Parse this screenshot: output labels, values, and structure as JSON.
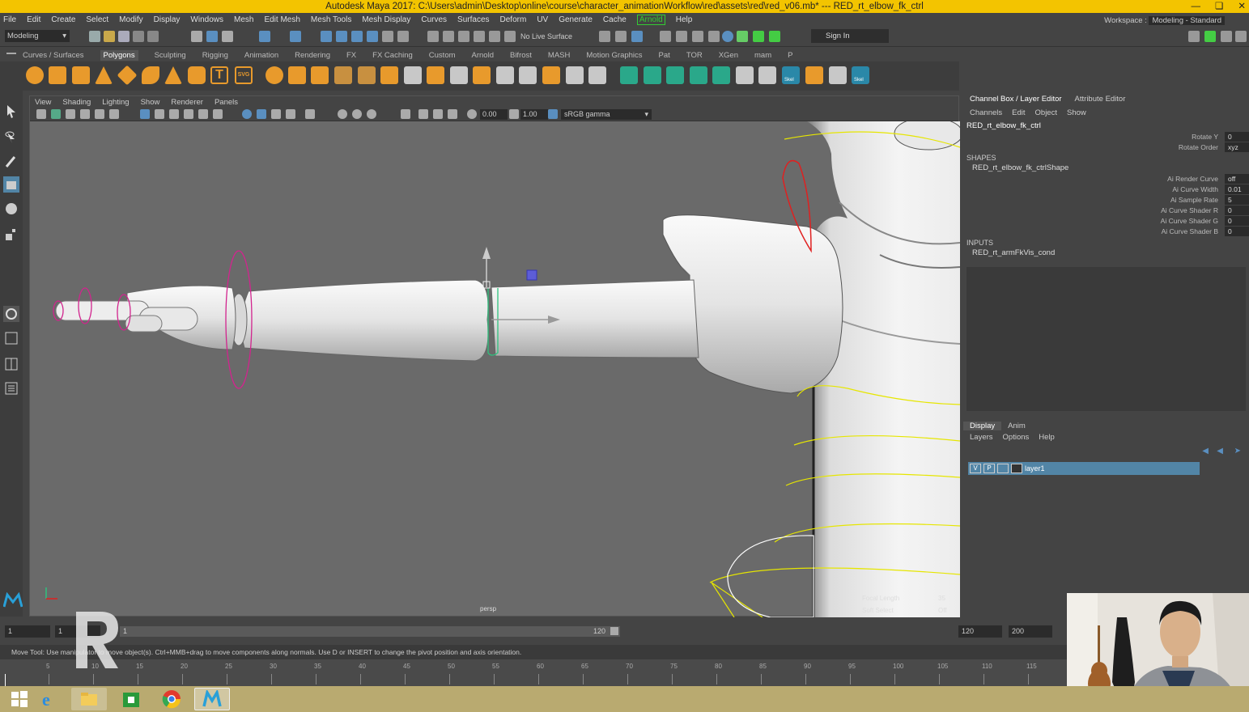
{
  "window": {
    "title": "Autodesk Maya 2017: C:\\Users\\admin\\Desktop\\online\\course\\character_animationWorkflow\\red\\assets\\red\\red_v06.mb*   ---   RED_rt_elbow_fk_ctrl"
  },
  "menubar": {
    "items": [
      "File",
      "Edit",
      "Create",
      "Select",
      "Modify",
      "Display",
      "Windows",
      "Mesh",
      "Edit Mesh",
      "Mesh Tools",
      "Mesh Display",
      "Curves",
      "Surfaces",
      "Deform",
      "UV",
      "Generate",
      "Cache",
      "Arnold",
      "Help"
    ]
  },
  "statusline": {
    "mode": "Modeling",
    "live_surface": "No Live Surface",
    "sign_in": "Sign In",
    "workspace_label": "Workspace :",
    "workspace_value": "Modeling - Standard"
  },
  "shelf": {
    "tabs": [
      "Curves / Surfaces",
      "Polygons",
      "Sculpting",
      "Rigging",
      "Animation",
      "Rendering",
      "FX",
      "FX Caching",
      "Custom",
      "Arnold",
      "Bifrost",
      "MASH",
      "Motion Graphics",
      "Pat",
      "TOR",
      "XGen",
      "mam",
      "P"
    ],
    "active_tab": "Polygons",
    "skel_label": "Skel"
  },
  "viewport": {
    "menu": [
      "View",
      "Shading",
      "Lighting",
      "Show",
      "Renderer",
      "Panels"
    ],
    "near_value": "0.00",
    "far_value": "1.00",
    "color_space": "sRGB gamma",
    "camera_label": "persp",
    "hud_focal_label": "Focal Length",
    "hud_focal_value": "35",
    "hud_soft_label": "Soft Select",
    "hud_soft_value": "Off"
  },
  "channel_box": {
    "tabs": [
      "Channel Box / Layer Editor",
      "Attribute Editor"
    ],
    "menu": [
      "Channels",
      "Edit",
      "Object",
      "Show"
    ],
    "object": "RED_rt_elbow_fk_ctrl",
    "attributes": [
      {
        "label": "Rotate Y",
        "value": "0"
      },
      {
        "label": "Rotate Order",
        "value": "xyz"
      }
    ],
    "shapes_header": "SHAPES",
    "shape_name": "RED_rt_elbow_fk_ctrlShape",
    "shape_attributes": [
      {
        "label": "Ai Render Curve",
        "value": "off"
      },
      {
        "label": "Ai Curve Width",
        "value": "0.01"
      },
      {
        "label": "Ai Sample Rate",
        "value": "5"
      },
      {
        "label": "Ai Curve Shader R",
        "value": "0"
      },
      {
        "label": "Ai Curve Shader G",
        "value": "0"
      },
      {
        "label": "Ai Curve Shader B",
        "value": "0"
      }
    ],
    "inputs_header": "INPUTS",
    "input_name": "RED_rt_armFkVis_cond"
  },
  "layer_editor": {
    "tabs": [
      "Display",
      "Anim"
    ],
    "menu": [
      "Layers",
      "Options",
      "Help"
    ],
    "layer": {
      "v": "V",
      "p": "P",
      "name": "layer1"
    }
  },
  "range": {
    "start": "1",
    "current": "1",
    "slider_start": "1",
    "slider_end": "120",
    "end": "120",
    "anim_end": "200"
  },
  "help_line": "Move Tool: Use manipulator to move object(s). Ctrl+MMB+drag to move components along normals. Use D or INSERT to change the pivot position and axis orientation.",
  "time_slider": {
    "ticks": [
      "5",
      "10",
      "15",
      "20",
      "25",
      "30",
      "35",
      "40",
      "45",
      "50",
      "55",
      "60",
      "65",
      "70",
      "75",
      "80",
      "85",
      "90",
      "95",
      "100",
      "105",
      "110",
      "115"
    ]
  },
  "colors": {
    "title_bar": "#f3c400",
    "accent": "#5285a6",
    "ik_handle": "#d2248e",
    "control_curve": "#e6e600",
    "selected_curve": "#e02020"
  }
}
